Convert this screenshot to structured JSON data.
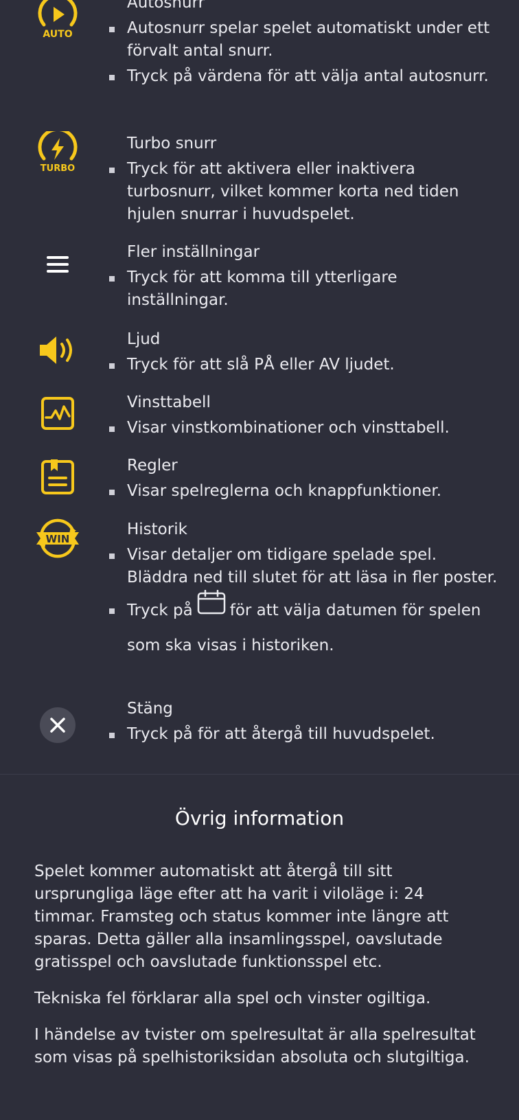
{
  "features": {
    "autospin": {
      "icon": "autospin-icon",
      "icon_label": "AUTO",
      "title": "Autosnurr",
      "bullets": [
        "Autosnurr spelar spelet automatiskt under ett förvalt antal snurr.",
        "Tryck på värdena för att välja antal autosnurr."
      ]
    },
    "turbo": {
      "icon": "turbo-icon",
      "icon_label": "TURBO",
      "title": "Turbo snurr",
      "bullets": [
        "Tryck för att aktivera eller inaktivera turbosnurr, vilket kommer korta ned tiden hjulen snurrar i huvudspelet."
      ]
    },
    "settings": {
      "icon": "menu-icon",
      "title": "Fler inställningar",
      "bullets": [
        "Tryck för att komma till ytterligare inställningar."
      ]
    },
    "sound": {
      "icon": "speaker-icon",
      "title": "Ljud",
      "bullets": [
        "Tryck för att slå PÅ eller AV ljudet."
      ]
    },
    "paytable": {
      "icon": "paytable-icon",
      "title": "Vinsttabell",
      "bullets": [
        "Visar vinstkombinationer och vinsttabell."
      ]
    },
    "rules": {
      "icon": "rules-icon",
      "title": "Regler",
      "bullets": [
        "Visar spelreglerna och knappfunktioner."
      ]
    },
    "history": {
      "icon": "history-win-icon",
      "icon_label": "WIN",
      "title": "Historik",
      "bullets": [
        "Visar detaljer om tidigare spelade spel. Bläddra ned till slutet för att läsa in fler poster."
      ],
      "calendar_bullet": {
        "before": "Tryck på",
        "icon": "calendar-icon",
        "after": "för att välja datumen för spelen som ska visas i historiken."
      }
    },
    "close": {
      "icon": "close-icon",
      "title": "Stäng",
      "bullets": [
        "Tryck på för att återgå till huvudspelet."
      ]
    }
  },
  "other_info": {
    "title": "Övrig information",
    "paragraphs": [
      "Spelet kommer automatiskt att återgå till sitt ursprungliga läge efter att ha varit i viloläge i: 24 timmar. Framsteg och status kommer inte längre att sparas. Detta gäller alla insamlingsspel, oavslutade gratisspel och oavslutade funktionsspel etc.",
      "Tekniska fel förklarar alla spel och vinster ogiltiga.",
      "I händelse av tvister om spelresultat är alla spelresultat som visas på spelhistoriksidan absoluta och slutgiltiga."
    ]
  },
  "colors": {
    "background": "#2d2e3a",
    "accent": "#f7c81c",
    "text": "#ebebf0",
    "close_button": "#4a4b57"
  }
}
